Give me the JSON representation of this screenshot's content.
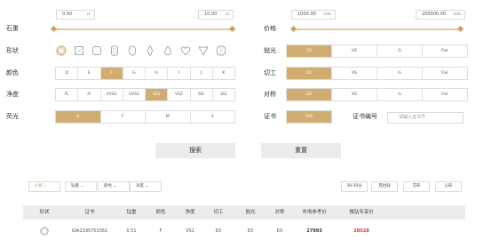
{
  "weight": {
    "label": "石重",
    "min_value": "0.50",
    "max_value": "10.00",
    "unit": "ct"
  },
  "price": {
    "label": "价格",
    "min_value": "1000.00",
    "max_value": "200000.00",
    "unit": "rmb"
  },
  "shape": {
    "label": "形状",
    "items": [
      "round-icon",
      "princess-icon",
      "cushion-icon",
      "emerald-icon",
      "oval-icon",
      "marquise-icon",
      "pear-icon",
      "heart-icon",
      "triangle-icon",
      "radiant-icon"
    ],
    "selected_index": 0
  },
  "color": {
    "label": "颜色",
    "options": [
      "D",
      "E",
      "F",
      "G",
      "H",
      "I",
      "J",
      "K"
    ]
  },
  "clarity": {
    "label": "净度",
    "options": [
      "FL",
      "IF",
      "VVS1",
      "VVS2",
      "VS1",
      "VS2",
      "SI1",
      "SI2"
    ]
  },
  "fluorescence": {
    "label": "荧光",
    "options": [
      "N",
      "F",
      "M",
      "S"
    ]
  },
  "polish": {
    "label": "抛光",
    "options": [
      "EX",
      "VG",
      "G",
      "Fair"
    ]
  },
  "cut": {
    "label": "切工",
    "options": [
      "EX",
      "VG",
      "G",
      "Fair"
    ]
  },
  "symmetry": {
    "label": "对称",
    "options": [
      "EX",
      "VG",
      "G",
      "Fair"
    ]
  },
  "certificate": {
    "label": "证书",
    "option": "GIA",
    "number_label": "证书编号",
    "number_placeholder": "请输入证书号"
  },
  "actions": {
    "search": "搜索",
    "reset": "重置"
  },
  "sort_bar": {
    "dropdowns": [
      "价格",
      "钻重",
      "颜色",
      "净度"
    ],
    "tabs": [
      "30-50分",
      "克拉钻",
      "方形",
      "心形"
    ]
  },
  "table": {
    "headers": [
      "形状",
      "证书",
      "钻重",
      "颜色",
      "净度",
      "切工",
      "抛光",
      "对称",
      "市场参考价",
      "搜钻专享价"
    ],
    "rows": [
      {
        "shape_icon": "round-icon",
        "certificate": "GIA2195701561",
        "weight": "0.51",
        "color": "F",
        "clarity": "VS1",
        "cut": "EX",
        "polish": "EX",
        "symmetry": "EX",
        "market_price": "27993",
        "member_price": "20528"
      }
    ]
  },
  "colors": {
    "accent": "#d2ad72",
    "price_red": "#e0302b"
  }
}
